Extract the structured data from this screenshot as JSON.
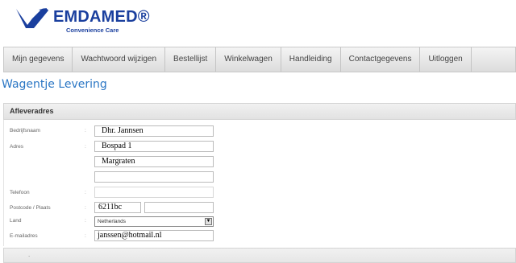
{
  "brand": {
    "name": "EMDAMED®",
    "tagline": "Convenience Care"
  },
  "nav": {
    "items": [
      "Mijn gegevens",
      "Wachtwoord wijzigen",
      "Bestellijst",
      "Winkelwagen",
      "Handleiding",
      "Contactgegevens",
      "Uitloggen"
    ]
  },
  "page": {
    "title": "Wagentje Levering"
  },
  "section": {
    "title": "Afleveradres"
  },
  "form": {
    "colon": ":",
    "bedrijfsnaam": {
      "label": "Bedrijfsnaam",
      "value": "Dhr. Jannsen"
    },
    "adres": {
      "label": "Adres",
      "line1": "Bospad 1",
      "line2": "Margraten",
      "line3": ""
    },
    "telefoon": {
      "label": "Telefoon",
      "value": ""
    },
    "postcode": {
      "label": "Postcode / Plaats",
      "postcode": "6211bc",
      "plaats": ""
    },
    "land": {
      "label": "Land",
      "value": "Netherlands"
    },
    "email": {
      "label": "E-mailadres",
      "value": "janssen@hotmail.nl"
    }
  },
  "bottom": {
    "text": "."
  },
  "colors": {
    "brand": "#1a3f9e",
    "title": "#2a76c4"
  }
}
